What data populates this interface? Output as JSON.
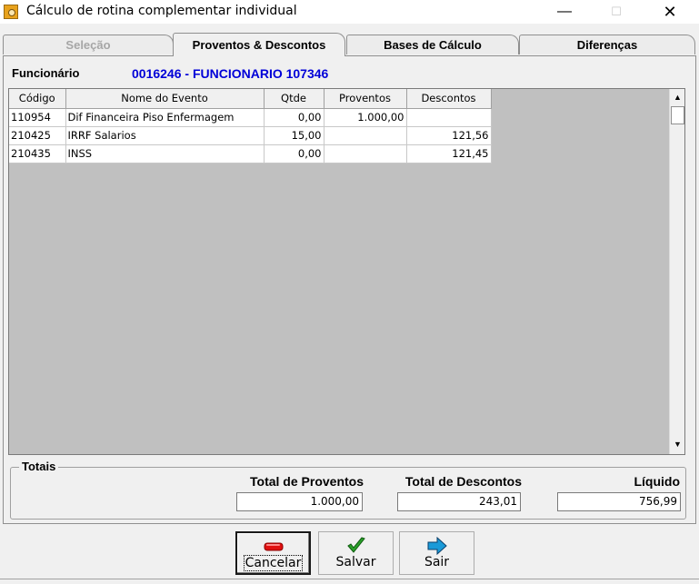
{
  "window": {
    "title": "Cálculo de rotina complementar individual",
    "minimize_glyph": "—",
    "maximize_glyph": "☐",
    "close_glyph": "✕"
  },
  "tabs": [
    {
      "label": "Seleção",
      "state": "disabled"
    },
    {
      "label": "Proventos & Descontos",
      "state": "active"
    },
    {
      "label": "Bases de Cálculo",
      "state": "normal"
    },
    {
      "label": "Diferenças",
      "state": "normal"
    }
  ],
  "employee": {
    "label": "Funcionário",
    "value": "0016246 - FUNCIONARIO 107346",
    "value_color": "#0000d8"
  },
  "grid": {
    "columns": [
      "Código",
      "Nome do Evento",
      "Qtde",
      "Proventos",
      "Descontos"
    ],
    "rows": [
      {
        "codigo": "110954",
        "nome": "Dif Financeira Piso Enfermagem",
        "qtde": "0,00",
        "proventos": "1.000,00",
        "descontos": ""
      },
      {
        "codigo": "210425",
        "nome": "IRRF Salarios",
        "qtde": "15,00",
        "proventos": "",
        "descontos": "121,56"
      },
      {
        "codigo": "210435",
        "nome": "INSS",
        "qtde": "0,00",
        "proventos": "",
        "descontos": "121,45"
      }
    ]
  },
  "totals": {
    "legend": "Totais",
    "proventos_label": "Total de Proventos",
    "proventos_value": "1.000,00",
    "descontos_label": "Total de Descontos",
    "descontos_value": "243,01",
    "liquido_label": "Líquido",
    "liquido_value": "756,99"
  },
  "buttons": {
    "cancel": "Cancelar",
    "save": "Salvar",
    "exit": "Sair"
  },
  "colors": {
    "grid_background": "#c0c0c0",
    "cancel_icon": "#e01010",
    "save_icon": "#2aa02a",
    "exit_icon": "#1a9ad8"
  }
}
